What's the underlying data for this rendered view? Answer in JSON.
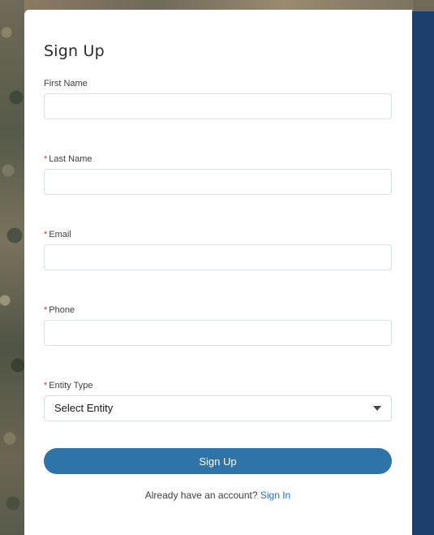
{
  "form": {
    "title": "Sign Up",
    "required_marker": "*",
    "fields": [
      {
        "label": "First Name",
        "value": "",
        "required": false
      },
      {
        "label": "Last Name",
        "value": "",
        "required": true
      },
      {
        "label": "Email",
        "value": "",
        "required": true
      },
      {
        "label": "Phone",
        "value": "",
        "required": true
      }
    ],
    "entity_type": {
      "label": "Entity Type",
      "selected": "Select Entity",
      "required": true
    },
    "submit_label": "Sign Up",
    "footer_text": "Already have an account?",
    "sign_in_link": "Sign In"
  },
  "colors": {
    "button": "#2e74a8",
    "link": "#1b74c9",
    "required": "#c23934",
    "side_panel": "#1c3f6e"
  }
}
